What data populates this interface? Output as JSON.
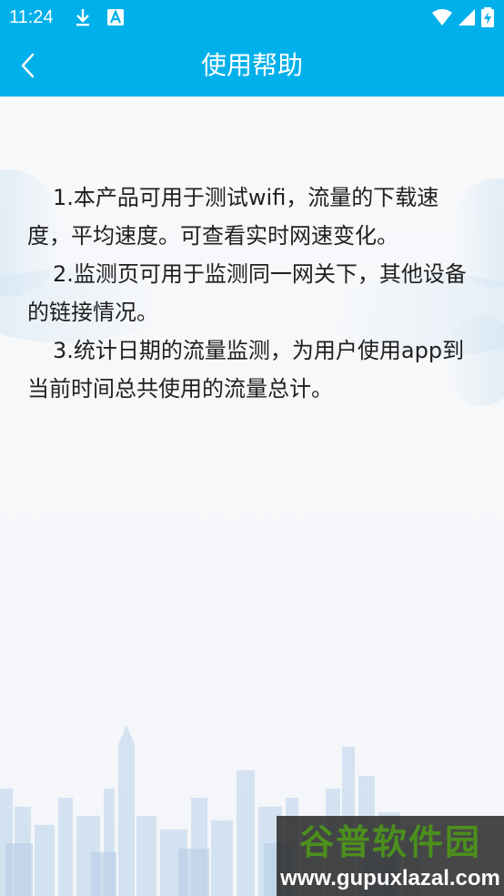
{
  "status_bar": {
    "time": "11:24",
    "icons": [
      "download-icon",
      "app-notification-icon",
      "wifi-icon",
      "signal-icon",
      "battery-charging-icon"
    ]
  },
  "app_bar": {
    "back_icon": "chevron-left-icon",
    "title": "使用帮助"
  },
  "help": {
    "paragraphs": [
      "1.本产品可用于测试wifi，流量的下载速度，平均速度。可查看实时网速变化。",
      "2.监测页可用于监测同一网关下，其他设备的链接情况。",
      "3.统计日期的流量监测，为用户使用app到当前时间总共使用的流量总计。"
    ]
  },
  "watermark": {
    "brand": "谷普软件园",
    "url": "www.gupuxlazal.com"
  },
  "colors": {
    "accent": "#00b0ea",
    "background": "#f7f8fa",
    "text": "#1f1f1f"
  }
}
